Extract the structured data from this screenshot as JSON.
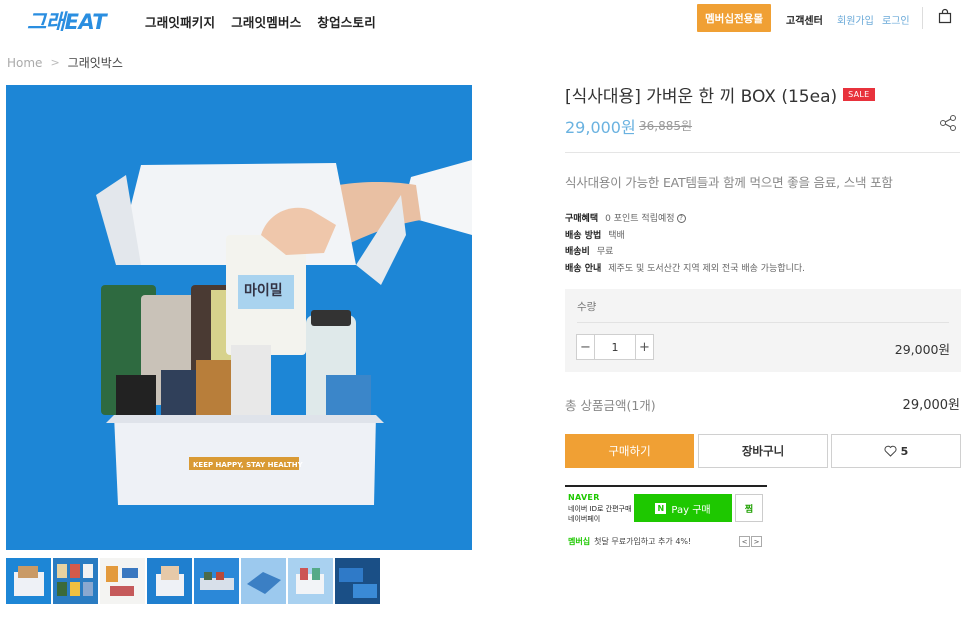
{
  "header": {
    "logo": "그래EAT",
    "nav": [
      "그래잇패키지",
      "그래잇멤버스",
      "창업스토리"
    ],
    "membership_button": "멤버십전용몰",
    "customer_center": "고객센터",
    "signup": "회원가입",
    "login": "로그인",
    "cart_icon": "shopping-bag-icon"
  },
  "breadcrumb": {
    "home": "Home",
    "current": "그래잇박스"
  },
  "product": {
    "title": "[식사대용] 가벼운 한 끼 BOX (15ea)",
    "sale_badge": "SALE",
    "price": "29,000원",
    "original_price": "36,885원",
    "description": "식사대용이 가능한 EAT템들과 함께 먹으면 좋을 음료, 스낵 포함",
    "box_print": "KEEP HAPPY, STAY HEALTHY",
    "carton_label": "마이밀",
    "thumbnail_count": 8,
    "meta": [
      {
        "key": "구매혜택",
        "value": "0 포인트 적립예정"
      },
      {
        "key": "배송 방법",
        "value": "택배"
      },
      {
        "key": "배송비",
        "value": "무료"
      },
      {
        "key": "배송 안내",
        "value": "제주도 및 도서산간 지역 제외 전국 배송 가능합니다."
      }
    ]
  },
  "quantity": {
    "label": "수량",
    "value": "1",
    "line_price": "29,000원"
  },
  "total": {
    "label": "총 상품금액(1개)",
    "value": "29,000원"
  },
  "actions": {
    "buy": "구매하기",
    "cart": "장바구니",
    "wish_count": "5"
  },
  "naver_pay": {
    "brand": "NAVER",
    "sub": "네이버 ID로 간편구매 네이버페이",
    "n_mark": "N",
    "pay_button": "Pay 구매",
    "jjim": "찜",
    "membership_label": "멤버십",
    "membership_text": "첫달 무료가입하고 추가 4%!"
  },
  "colors": {
    "accent_orange": "#f0a034",
    "price_blue": "#6ab2e0",
    "logo_blue": "#2a8ee0",
    "sale_red": "#e8323c",
    "naver_green": "#1ec800",
    "photo_background": "#1d86d6"
  }
}
